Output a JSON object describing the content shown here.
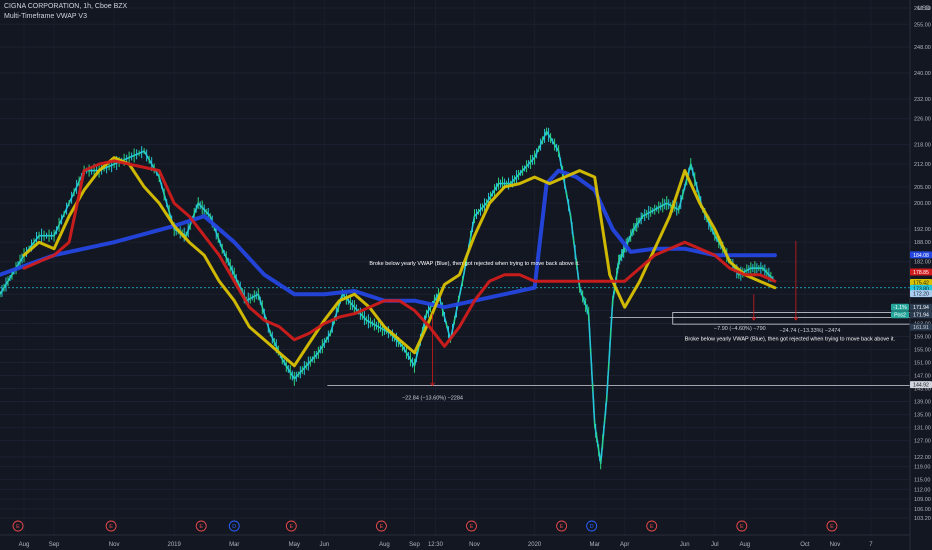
{
  "header": {
    "title": "CIGNA CORPORATION, 1h, Cboe BZX",
    "indicator": "Multi-Timeframe VWAP V3"
  },
  "chart_data": {
    "type": "line",
    "currency": "USD",
    "yaxis_ticks": [
      103.2,
      106.0,
      109.0,
      112.0,
      115.0,
      119.0,
      122.0,
      127.0,
      131.0,
      135.0,
      139.0,
      143.0,
      147.0,
      151.0,
      155.0,
      159.0,
      163.0,
      167.0,
      172.0,
      176.0,
      182.0,
      188.0,
      192.0,
      200.0,
      205.0,
      212.0,
      218.0,
      226.0,
      232.0,
      240.0,
      248.0,
      255.0,
      260.0
    ],
    "xaxis_ticks": [
      {
        "label": "Aug",
        "x": 0.0
      },
      {
        "label": "Sep",
        "x": 1.0
      },
      {
        "label": "Nov",
        "x": 3.0
      },
      {
        "label": "2019",
        "x": 5.0
      },
      {
        "label": "Mar",
        "x": 7.0
      },
      {
        "label": "May",
        "x": 9.0
      },
      {
        "label": "Jun",
        "x": 10.0
      },
      {
        "label": "Aug",
        "x": 12.0
      },
      {
        "label": "Sep",
        "x": 13.0
      },
      {
        "label": "12:30",
        "x": 13.7
      },
      {
        "label": "Nov",
        "x": 15.0
      },
      {
        "label": "2020",
        "x": 17.0
      },
      {
        "label": "Mar",
        "x": 19.0
      },
      {
        "label": "Apr",
        "x": 20.0
      },
      {
        "label": "Jun",
        "x": 22.0
      },
      {
        "label": "Jul",
        "x": 23.0
      },
      {
        "label": "Aug",
        "x": 24.0
      },
      {
        "label": "Oct",
        "x": 26.0
      },
      {
        "label": "Nov",
        "x": 27.0
      },
      {
        "label": "7",
        "x": 28.2
      }
    ],
    "xlim": [
      -0.8,
      29.5
    ],
    "ylim": [
      103.2,
      260.0
    ],
    "events": [
      {
        "label": "E",
        "x": -0.2,
        "color": "#e84a4a"
      },
      {
        "label": "E",
        "x": 2.9,
        "color": "#e84a4a"
      },
      {
        "label": "E",
        "x": 5.9,
        "color": "#e84a4a"
      },
      {
        "label": "D",
        "x": 7.0,
        "color": "#2962ff"
      },
      {
        "label": "E",
        "x": 8.9,
        "color": "#e84a4a"
      },
      {
        "label": "E",
        "x": 11.9,
        "color": "#e84a4a"
      },
      {
        "label": "E",
        "x": 14.9,
        "color": "#e84a4a"
      },
      {
        "label": "E",
        "x": 17.9,
        "color": "#e84a4a"
      },
      {
        "label": "D",
        "x": 18.9,
        "color": "#2962ff"
      },
      {
        "label": "E",
        "x": 20.9,
        "color": "#e84a4a"
      },
      {
        "label": "E",
        "x": 23.9,
        "color": "#e84a4a"
      },
      {
        "label": "E",
        "x": 26.9,
        "color": "#e84a4a"
      }
    ],
    "price": {
      "name": "",
      "color": "#26c6da",
      "x": [
        -0.8,
        -0.4,
        0.0,
        0.5,
        1.0,
        1.5,
        2.0,
        2.5,
        3.0,
        3.5,
        4.0,
        4.5,
        5.0,
        5.4,
        5.8,
        6.2,
        6.6,
        7.0,
        7.4,
        7.8,
        8.2,
        8.6,
        9.0,
        9.4,
        9.8,
        10.2,
        10.6,
        11.0,
        11.4,
        11.8,
        12.2,
        12.6,
        13.0,
        13.4,
        13.8,
        14.2,
        14.6,
        15.0,
        15.4,
        15.8,
        16.2,
        16.6,
        17.0,
        17.4,
        17.8,
        18.2,
        18.5,
        18.8,
        19.0,
        19.2,
        19.4,
        19.6,
        19.8,
        20.0,
        20.3,
        20.6,
        21.0,
        21.4,
        21.8,
        22.2,
        22.6,
        23.0,
        23.4,
        23.8,
        24.2,
        24.6,
        25.0
      ],
      "values": [
        172,
        178,
        184,
        190,
        190,
        200,
        210,
        210,
        212,
        214,
        216,
        208,
        192,
        190,
        200,
        196,
        186,
        178,
        170,
        172,
        160,
        152,
        146,
        150,
        154,
        160,
        172,
        168,
        164,
        162,
        160,
        156,
        150,
        166,
        172,
        158,
        176,
        196,
        200,
        206,
        206,
        210,
        214,
        222,
        216,
        196,
        174,
        166,
        132,
        120,
        140,
        170,
        182,
        186,
        192,
        196,
        198,
        200,
        198,
        212,
        198,
        190,
        184,
        178,
        180,
        180,
        176
      ]
    },
    "series": [
      {
        "name": "",
        "color": "#2446e0",
        "width": 4,
        "x": [
          -0.8,
          1,
          3,
          5,
          6,
          7,
          8,
          9,
          10,
          11,
          12,
          13,
          14,
          15,
          16,
          17,
          17.4,
          17.8,
          18.4,
          19,
          19.6,
          20.2,
          21,
          22,
          23,
          24,
          25
        ],
        "values": [
          178,
          184,
          188,
          193,
          196,
          188,
          178,
          172,
          172,
          173,
          170,
          170,
          168,
          170,
          172,
          174,
          206,
          210,
          208,
          204,
          192,
          185,
          186,
          186,
          184,
          184,
          184
        ]
      },
      {
        "name": "",
        "color": "#d9c100",
        "width": 3,
        "x": [
          0,
          0.5,
          1,
          1.5,
          2,
          2.5,
          3,
          3.5,
          4,
          4.5,
          5,
          5.5,
          6,
          6.5,
          7,
          7.5,
          8,
          8.5,
          9,
          9.5,
          10,
          10.5,
          11,
          11.5,
          12,
          12.5,
          13,
          13.5,
          14,
          14.5,
          15,
          15.5,
          16,
          16.5,
          17,
          17.5,
          18,
          18.5,
          19,
          19.5,
          20,
          20.5,
          21,
          21.5,
          22,
          22.5,
          23,
          23.5,
          24,
          24.5,
          25
        ],
        "values": [
          184,
          188,
          186,
          196,
          204,
          210,
          214,
          212,
          205,
          200,
          193,
          188,
          184,
          176,
          170,
          162,
          158,
          154,
          150,
          157,
          164,
          170,
          172,
          168,
          162,
          158,
          154,
          164,
          175,
          178,
          190,
          200,
          205,
          206,
          208,
          206,
          208,
          210,
          208,
          178,
          168,
          176,
          186,
          196,
          210,
          200,
          192,
          182,
          178,
          176,
          174
        ]
      },
      {
        "name": "",
        "color": "#d01c1c",
        "width": 3,
        "x": [
          0,
          0.5,
          1,
          1.5,
          2,
          2.5,
          3,
          3.5,
          4,
          4.5,
          5,
          5.5,
          6,
          6.5,
          7,
          7.5,
          8,
          8.5,
          9,
          9.5,
          10,
          10.5,
          11,
          11.5,
          12,
          12.5,
          13,
          13.5,
          14,
          14.5,
          15,
          15.5,
          16,
          16.5,
          17,
          17.5,
          18,
          18.5,
          19,
          19.5,
          20,
          20.5,
          21,
          21.5,
          22,
          22.5,
          23,
          23.5,
          24,
          24.5,
          25
        ],
        "values": [
          180,
          182,
          184,
          188,
          210,
          212,
          213,
          212,
          211,
          210,
          200,
          196,
          190,
          184,
          176,
          168,
          164,
          162,
          158,
          160,
          163,
          165,
          166,
          168,
          170,
          170,
          167,
          162,
          156,
          162,
          170,
          176,
          178,
          178,
          176,
          176,
          176,
          176,
          176,
          176,
          176,
          180,
          184,
          186,
          188,
          186,
          184,
          180,
          178,
          178,
          176
        ]
      }
    ],
    "hlines": [
      {
        "y": 174,
        "color": "#26c6da",
        "dash": true,
        "x0": -0.8,
        "x1": 29.5
      }
    ],
    "level_lines": [
      {
        "y": 143.9,
        "x0": 10.1,
        "x1": 29.5,
        "color": "#d1d4dc"
      },
      {
        "y": 164.8,
        "x0": 19.5,
        "x1": 29.5,
        "color": "#d1d4dc"
      }
    ],
    "boxes": [
      {
        "x0": 21.6,
        "x1": 29.5,
        "y0": 162.8,
        "y1": 166.4,
        "color": "#d1d4dc"
      }
    ],
    "vmeasures": [
      {
        "x": 13.6,
        "y0": 166.0,
        "y1": 143.9,
        "color": "#d01c1c",
        "label": "−22.84 (−13.60%) −2284"
      },
      {
        "x": 24.3,
        "y0": 172.0,
        "y1": 164.0,
        "color": "#d01c1c",
        "label": "−7.90 (−4.60%) −790"
      },
      {
        "x": 25.7,
        "y0": 188.4,
        "y1": 164.0,
        "color": "#d01c1c",
        "label": "−24.74 (−13.33%) −2474"
      }
    ],
    "annotations": [
      {
        "text": "Broke below yearly VWAP (Blue), then got rejected when trying to move back above it.",
        "x": 15.0,
        "y": 181.0
      },
      {
        "text": "Broke below yearly VWAP (Blue), then got rejected when trying to move back above it.",
        "x": 25.5,
        "y": 157.8
      }
    ],
    "price_tags": [
      {
        "text": "184.08",
        "y": 184.08,
        "bg": "#2446e0",
        "fg": "#ffffff"
      },
      {
        "text": "178.85",
        "y": 178.85,
        "bg": "#d01c1c",
        "fg": "#ffffff"
      },
      {
        "text": "175.42",
        "y": 175.6,
        "bg": "#d9c100",
        "fg": "#131722"
      },
      {
        "text": "173.80",
        "y": 173.8,
        "bg": "#26c6da",
        "fg": "#131722"
      },
      {
        "text": "172.20",
        "y": 172.2,
        "bg": "#aaccee",
        "fg": "#131722"
      },
      {
        "text": "-1.1%",
        "y": 168.0,
        "bg": "#26a69a",
        "fg": "#ffffff"
      },
      {
        "text": "171.94",
        "y": 168.0,
        "bg": "#2b3b50",
        "fg": "#ffffff"
      },
      {
        "text": "Pos2",
        "y": 165.7,
        "bg": "#26a69a",
        "fg": "#ffffff"
      },
      {
        "text": "171.94",
        "y": 165.7,
        "bg": "#2b3b50",
        "fg": "#ffffff"
      },
      {
        "text": "161.91",
        "y": 161.91,
        "bg": "#2b3b50",
        "fg": "#d1d4dc"
      },
      {
        "text": "144.92",
        "y": 144.2,
        "bg": "#d1d4dc",
        "fg": "#131722"
      }
    ]
  }
}
